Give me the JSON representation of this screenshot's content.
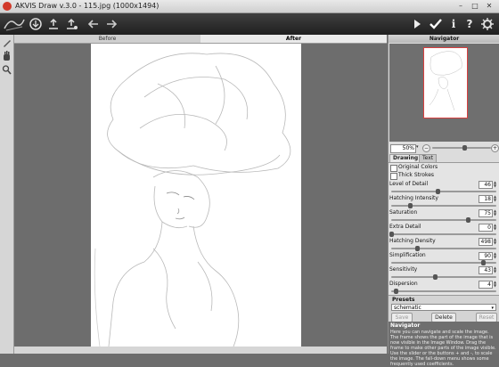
{
  "window": {
    "title": "AKVIS Draw v.3.0 - 115.jpg (1000x1494)",
    "controls": [
      "–",
      "□",
      "✕"
    ]
  },
  "toolbar": {
    "left_icons": [
      "logo-icon",
      "open-image-icon",
      "save-image-icon",
      "batch-icon",
      "undo-icon",
      "redo-icon"
    ],
    "right_icons": [
      "run-icon",
      "apply-icon",
      "info-icon",
      "help-icon",
      "settings-icon"
    ]
  },
  "tools": [
    "pencil-icon",
    "hand-icon",
    "zoom-icon"
  ],
  "view_tabs": {
    "before": "Before",
    "after": "After",
    "active": "after"
  },
  "navigator": {
    "title": "Navigator",
    "zoom": "50%",
    "zoom_level": 0.55
  },
  "panel_tabs": {
    "drawing": "Drawing",
    "text": "Text",
    "active": "drawing"
  },
  "checkboxes": [
    {
      "label": "Original Colors",
      "checked": false
    },
    {
      "label": "Thick Strokes",
      "checked": false
    }
  ],
  "parameters": [
    {
      "label": "Level of Detail",
      "value": "46",
      "fraction": 0.46
    },
    {
      "label": "Hatching Intensity",
      "value": "18",
      "fraction": 0.18
    },
    {
      "label": "Saturation",
      "value": "75",
      "fraction": 0.75
    },
    {
      "label": "Extra Detail",
      "value": "0",
      "fraction": 0.0
    },
    {
      "label": "Hatching Density",
      "value": "498",
      "fraction": 0.25
    },
    {
      "label": "Simplification",
      "value": "90",
      "fraction": 0.9
    },
    {
      "label": "Sensitivity",
      "value": "43",
      "fraction": 0.43
    },
    {
      "label": "Dispersion",
      "value": "4",
      "fraction": 0.04
    }
  ],
  "presets": {
    "title": "Presets",
    "selected": "schematic",
    "save": "Save",
    "delete": "Delete",
    "reset": "Reset"
  },
  "help": {
    "title": "Navigator",
    "text": "Here you can navigate and scale the image. The frame shows the part of the image that is now visible in the Image Window. Drag the frame to make other parts of the image visible. Use the slider or the buttons + and -, to scale the image. The fall-down menu shows some frequently used coefficients."
  },
  "colors": {
    "toolbar": "#2a2a2a",
    "panel": "#dcdcdc",
    "workspace": "#6d6d6d",
    "nav_frame": "#d94040"
  }
}
